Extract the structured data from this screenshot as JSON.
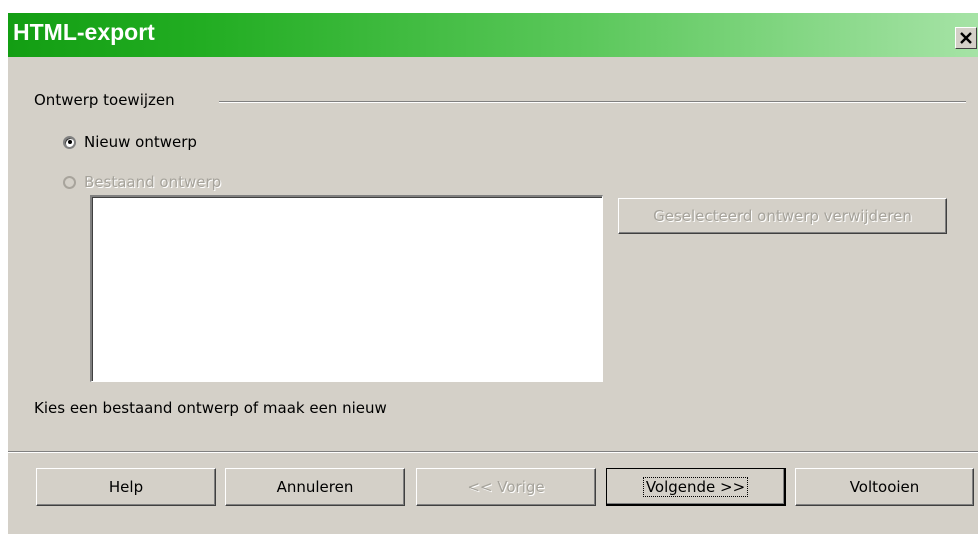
{
  "window": {
    "title": "HTML-export"
  },
  "group": {
    "label": "Ontwerp toewijzen"
  },
  "options": {
    "new_design": {
      "label": "Nieuw ontwerp",
      "selected": true,
      "enabled": true
    },
    "existing_design": {
      "label": "Bestaand ontwerp",
      "selected": false,
      "enabled": false
    }
  },
  "design_list": {
    "items": []
  },
  "actions": {
    "delete_label": "Geselecteerd ontwerp verwijderen"
  },
  "hint": "Kies een bestaand ontwerp of maak een nieuw",
  "footer": {
    "help_label": "Help",
    "cancel_label": "Annuleren",
    "prev_label": "<< Vorige",
    "next_label": "Volgende >>",
    "finish_label": "Voltooien"
  },
  "colors": {
    "titlebar_start": "#139e13",
    "titlebar_end": "#a6e3a6",
    "dialog_bg": "#d4d0c8",
    "disabled_text": "#a6a39b"
  },
  "icons": {
    "close": "close-icon"
  }
}
